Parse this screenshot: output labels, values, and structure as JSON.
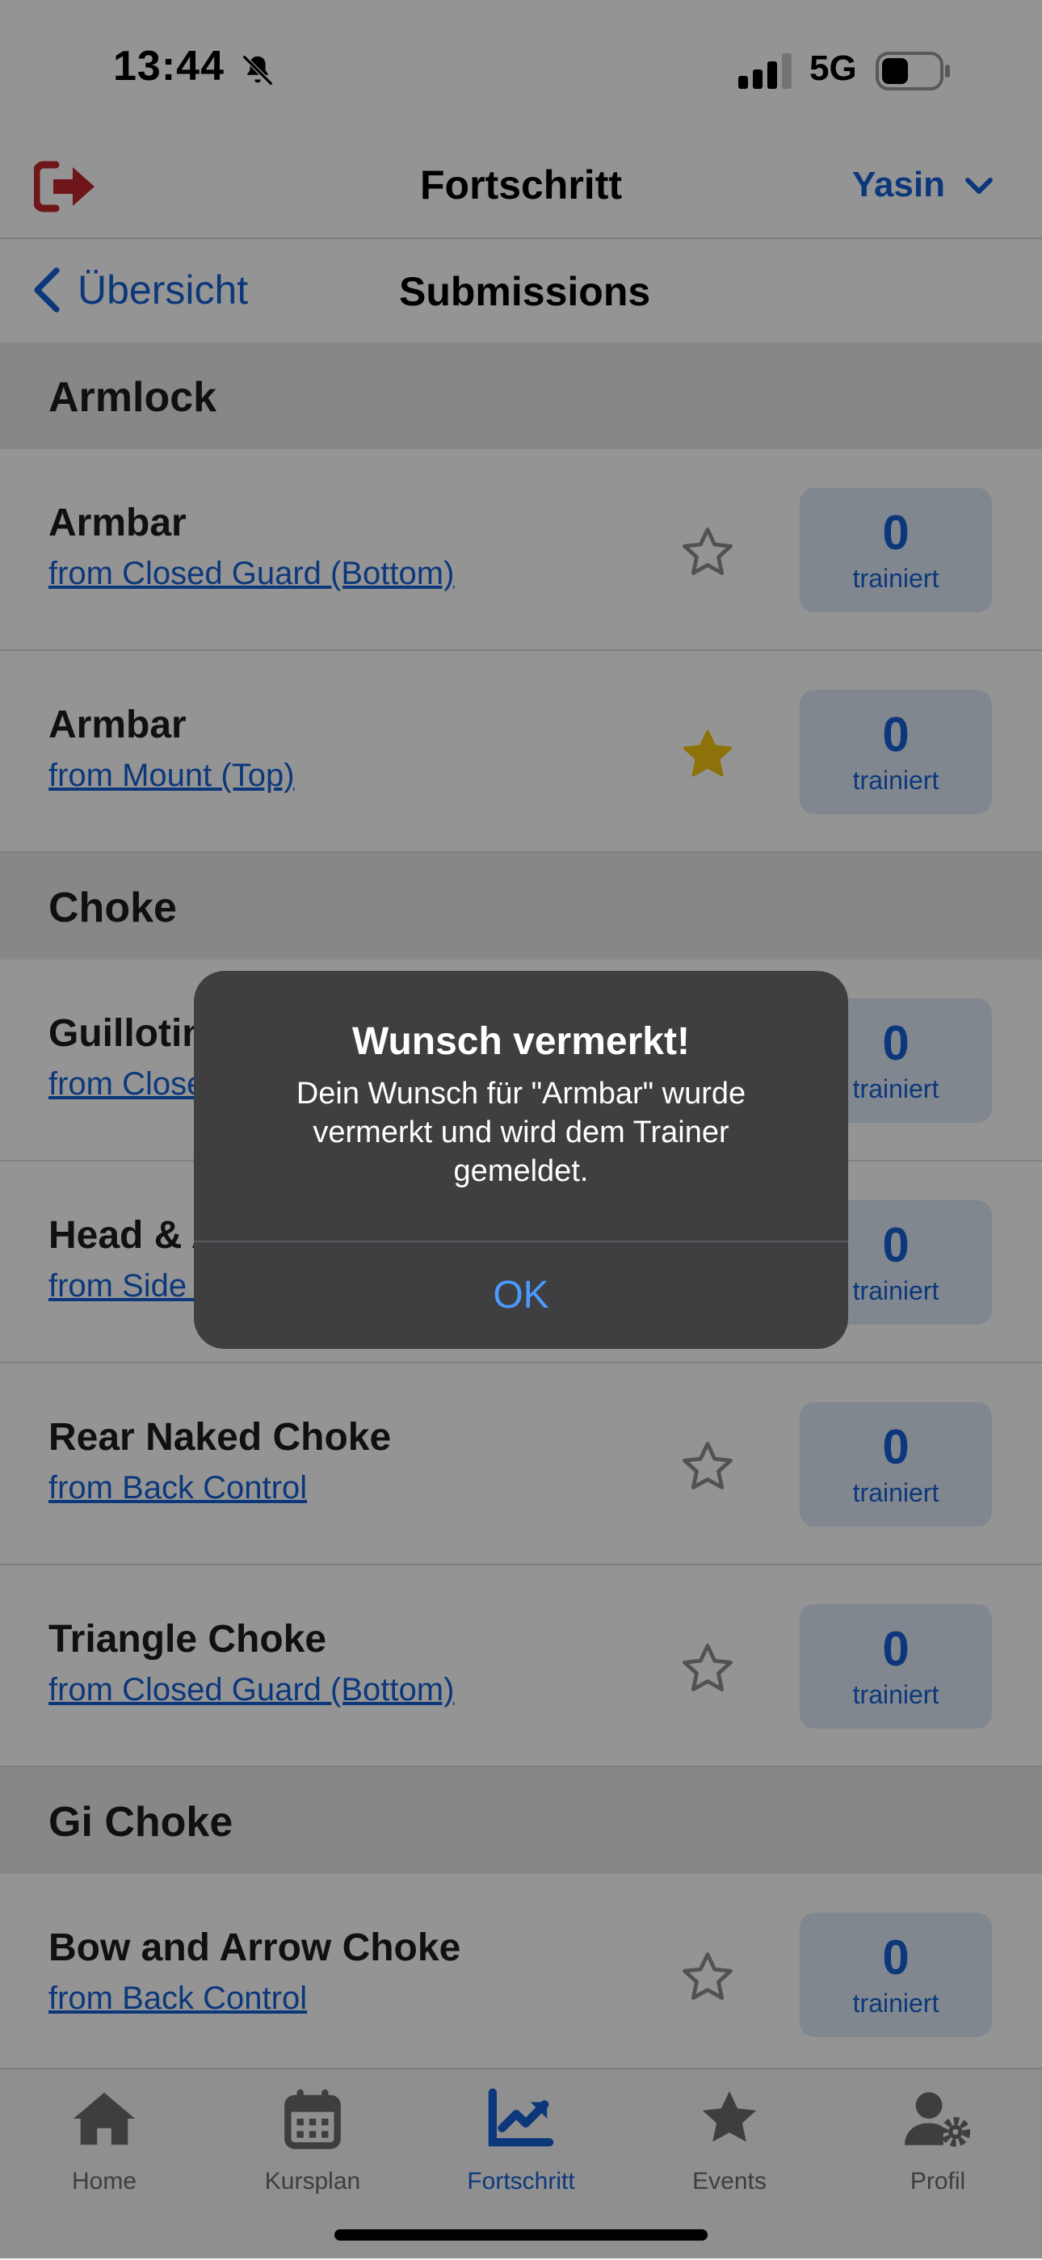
{
  "status_bar": {
    "time": "13:44",
    "network": "5G"
  },
  "header": {
    "title": "Fortschritt",
    "user_name": "Yasin"
  },
  "sub_header": {
    "back_label": "Übersicht",
    "title": "Submissions"
  },
  "sections": [
    {
      "name": "Armlock"
    },
    {
      "name": "Choke"
    },
    {
      "name": "Gi Choke"
    }
  ],
  "rows": [
    {
      "title": "Armbar",
      "subtitle": "from Closed Guard (Bottom)",
      "count": "0",
      "count_label": "trainiert",
      "favorited": false
    },
    {
      "title": "Armbar",
      "subtitle": "from Mount (Top)",
      "count": "0",
      "count_label": "trainiert",
      "favorited": true
    },
    {
      "title": "Guillotine",
      "subtitle": "from Closed Guard",
      "count": "0",
      "count_label": "trainiert",
      "favorited": false
    },
    {
      "title": "Head & Arm",
      "subtitle": "from Side Control",
      "count": "0",
      "count_label": "trainiert",
      "favorited": false
    },
    {
      "title": "Rear Naked Choke",
      "subtitle": "from Back Control",
      "count": "0",
      "count_label": "trainiert",
      "favorited": false
    },
    {
      "title": "Triangle Choke",
      "subtitle": "from Closed Guard (Bottom)",
      "count": "0",
      "count_label": "trainiert",
      "favorited": false
    },
    {
      "title": "Bow and Arrow Choke",
      "subtitle": "from Back Control",
      "count": "0",
      "count_label": "trainiert",
      "favorited": false
    }
  ],
  "alert": {
    "title": "Wunsch vermerkt!",
    "message": "Dein Wunsch für \"Armbar\" wurde vermerkt und wird dem Trainer gemeldet.",
    "ok_label": "OK"
  },
  "tabs": [
    {
      "label": "Home",
      "icon": "home-icon",
      "active": false
    },
    {
      "label": "Kursplan",
      "icon": "calendar-icon",
      "active": false
    },
    {
      "label": "Fortschritt",
      "icon": "chart-line-icon",
      "active": true
    },
    {
      "label": "Events",
      "icon": "star-icon",
      "active": false
    },
    {
      "label": "Profil",
      "icon": "user-gear-icon",
      "active": false
    }
  ],
  "colors": {
    "accent": "#1661d4",
    "logout": "#c0262d",
    "favorite_star": "#f2c511",
    "alert_bg": "#3f3f41",
    "alert_button": "#4a9bff"
  }
}
